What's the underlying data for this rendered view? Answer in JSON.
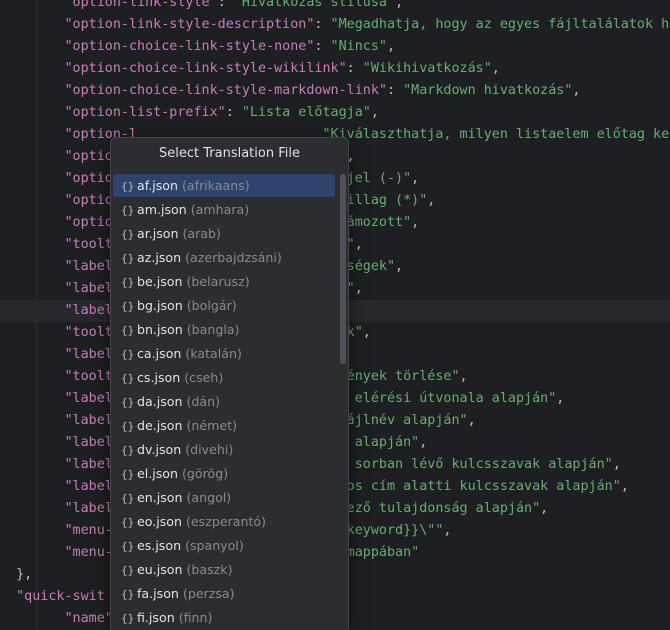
{
  "editor": {
    "lines": [
      {
        "indent": "    ",
        "key": "\"option-link-style\"",
        "sep": ": ",
        "value": "\"Hivatkozás stílusa\"",
        "tail": ","
      },
      {
        "indent": "    ",
        "key": "\"option-link-style-description\"",
        "sep": ": ",
        "value": "\"Megadhatja, hogy az egyes fájltalálatok hiv",
        "tail": ""
      },
      {
        "indent": "    ",
        "key": "\"option-choice-link-style-none\"",
        "sep": ": ",
        "value": "\"Nincs\"",
        "tail": ","
      },
      {
        "indent": "    ",
        "key": "\"option-choice-link-style-wikilink\"",
        "sep": ": ",
        "value": "\"Wikihivatkozás\"",
        "tail": ","
      },
      {
        "indent": "    ",
        "key": "\"option-choice-link-style-markdown-link\"",
        "sep": ": ",
        "value": "\"Markdown hivatkozás\"",
        "tail": ","
      },
      {
        "indent": "    ",
        "key": "\"option-list-prefix\"",
        "sep": ": ",
        "value": "\"Lista előtagja\"",
        "tail": ","
      },
      {
        "indent": "    ",
        "key": "\"option-l",
        "sep": "",
        "value": "                       \"Kiválaszthatja, milyen listaelem előtag ke",
        "tail": ""
      },
      {
        "indent": "    ",
        "key": "\"option",
        "sep": "",
        "value": "                         cs\"",
        "tail": ","
      },
      {
        "indent": "    ",
        "key": "\"option",
        "sep": "",
        "value": "                          tőjel (-)\"",
        "tail": ","
      },
      {
        "indent": "    ",
        "key": "\"option",
        "sep": "",
        "value": "                         \"Csillag (*)\"",
        "tail": ","
      },
      {
        "indent": "    ",
        "key": "\"option",
        "sep": "",
        "value": "                         \"Számozott\"",
        "tail": ","
      },
      {
        "indent": "    ",
        "key": "\"toolti",
        "sep": "",
        "value": "                        lése\"",
        "tail": ","
      },
      {
        "indent": "    ",
        "key": "\"label-",
        "sep": "",
        "value": "                        hetőségek\"",
        "tail": ","
      },
      {
        "indent": "    ",
        "key": "\"label-",
        "sep": "",
        "value": "                        agok\"",
        "tail": ","
      },
      {
        "indent": "    ",
        "key": "\"label-",
        "sep": "",
        "value": "",
        "tail": ""
      },
      {
        "indent": "    ",
        "key": "\"toolti",
        "sep": "",
        "value": "                        ációk\"",
        "tail": ","
      },
      {
        "indent": "    ",
        "key": "\"label-",
        "sep": "",
        "value": "",
        "tail": ""
      },
      {
        "indent": "    ",
        "key": "\"toolti",
        "sep": "",
        "value": "                        lőzmények törlése\"",
        "tail": ","
      },
      {
        "indent": "    ",
        "key": "\"label-",
        "sep": "",
        "value": "                        fájl elérési útvonala alapján\"",
        "tail": ","
      },
      {
        "indent": "    ",
        "key": "\"label-",
        "sep": "",
        "value": "                        \"a fájlnév alapján\"",
        "tail": ","
      },
      {
        "indent": "    ",
        "key": "\"label-",
        "sep": "",
        "value": "                        mkék alapján\"",
        "tail": ","
      },
      {
        "indent": "    ",
        "key": "\"label-",
        "sep": "",
        "value": "                        onos sorban lévő kulcsszavak alapján\"",
        "tail": ","
      },
      {
        "indent": "    ",
        "key": "\"label-",
        "sep": "",
        "value": "                        azonos cím alatti kulcsszavak alapján\"",
        "tail": ","
      },
      {
        "indent": "    ",
        "key": "\"label-",
        "sep": "",
        "value": "                        \"egyező tulajdonság alapján\"",
        "tail": ","
      },
      {
        "indent": "    ",
        "key": "\"menu-o",
        "sep": "",
        "value": "                        \\\"{{keyword}}\\\"\"",
        "tail": ","
      },
      {
        "indent": "    ",
        "key": "\"menu-o",
        "sep": "",
        "value": "                        s a mappában\"",
        "tail": ""
      },
      {
        "indent": "",
        "key": "",
        "sep": "",
        "value": "",
        "tail": "},"
      },
      {
        "indent": "",
        "key": "\"quick-swit",
        "sep": "",
        "value": "",
        "tail": ""
      },
      {
        "indent": "    ",
        "key": "\"name\"",
        "sep": ": ",
        "value": "",
        "tail": ""
      }
    ]
  },
  "popup": {
    "title": "Select Translation File",
    "items": [
      {
        "file": "af.json",
        "lang": "(afrikaans)"
      },
      {
        "file": "am.json",
        "lang": "(amhara)"
      },
      {
        "file": "ar.json",
        "lang": "(arab)"
      },
      {
        "file": "az.json",
        "lang": "(azerbajdzsáni)"
      },
      {
        "file": "be.json",
        "lang": "(belarusz)"
      },
      {
        "file": "bg.json",
        "lang": "(bolgár)"
      },
      {
        "file": "bn.json",
        "lang": "(bangla)"
      },
      {
        "file": "ca.json",
        "lang": "(katalán)"
      },
      {
        "file": "cs.json",
        "lang": "(cseh)"
      },
      {
        "file": "da.json",
        "lang": "(dán)"
      },
      {
        "file": "de.json",
        "lang": "(német)"
      },
      {
        "file": "dv.json",
        "lang": "(divehi)"
      },
      {
        "file": "el.json",
        "lang": "(görög)"
      },
      {
        "file": "en.json",
        "lang": "(angol)"
      },
      {
        "file": "eo.json",
        "lang": "(eszperantó)"
      },
      {
        "file": "es.json",
        "lang": "(spanyol)"
      },
      {
        "file": "eu.json",
        "lang": "(baszk)"
      },
      {
        "file": "fa.json",
        "lang": "(perzsa)"
      },
      {
        "file": "fi.json",
        "lang": "(finn)"
      }
    ],
    "selected_index": 0,
    "item_icon": "{}"
  },
  "colors": {
    "background": "#1e1f22",
    "key": "#c77dbb",
    "string": "#6aab73",
    "selection": "#2e436e"
  }
}
